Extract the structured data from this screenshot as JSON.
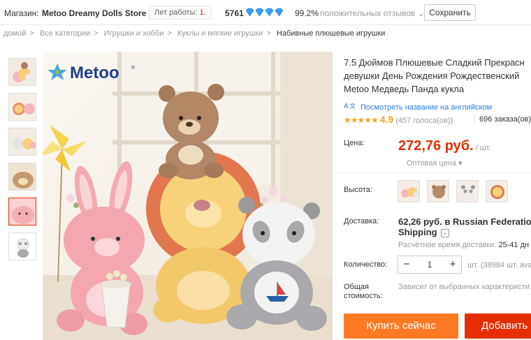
{
  "store_bar": {
    "label": "Магазин:",
    "store_name": "Metoo Dreamy Dolls Store",
    "years_label": "Лет работы:",
    "years_value": "1",
    "years_suffix": ".",
    "score": "5761",
    "positive_pct": "99.2%",
    "feedback_label": "положительных отзывов",
    "save_button": "Сохранить"
  },
  "breadcrumbs": [
    "домой",
    "Все категории",
    "Игрушки и хобби",
    "Куклы и мягкие игрушки",
    "Набивные плюшевые игрушки"
  ],
  "brand_logo": "Metoo",
  "product": {
    "title_lines": [
      "7.5 Дюймов Плюшевые Сладкий Прекрасн",
      "девушки День Рождения Рождественский",
      "Metoo Медведь Панда кукла"
    ],
    "translate_link": "Посмотреть название на английском",
    "rating": "4.9",
    "votes": "(457 голоса(ов))",
    "orders": "696 заказа(ов)",
    "price_label": "Цена:",
    "price": "272,76 руб.",
    "price_unit": "/ шт.",
    "wholesale": "Оптовая цена",
    "height_label": "Высота:",
    "delivery_label": "Доставка:",
    "shipping_price": "62,26 руб.",
    "shipping_to_prefix": "в",
    "shipping_to": "Russian Federatio",
    "shipping_word": "Shipping",
    "delivery_time_label": "Расчётное время доставки:",
    "delivery_time": "25-41 дн",
    "quantity_label": "Количество:",
    "quantity_value": "1",
    "stock": "шт. (38984 шт. ava",
    "total_label_1": "Общая",
    "total_label_2": "стоимость:",
    "total_value": "Зависит от выбранных характеристи",
    "buy_now": "Купить сейчас",
    "add_to_cart": "Добавить"
  },
  "colors": {
    "accent_red": "#e62e04",
    "buy_orange": "#ff7a23",
    "link_blue": "#2a7ce1",
    "star_orange": "#f5a623"
  }
}
